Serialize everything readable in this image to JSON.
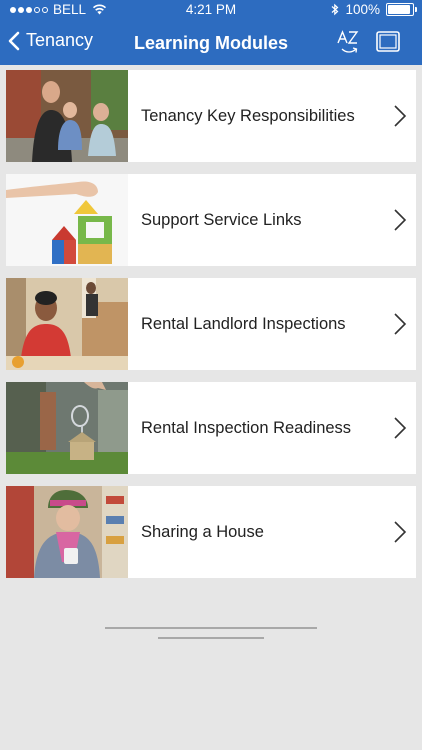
{
  "status_bar": {
    "carrier": "BELL",
    "time": "4:21 PM",
    "battery": "100%",
    "battery_level": 1.0
  },
  "nav": {
    "back_label": "Tenancy",
    "title": "Learning Modules",
    "sort_icon": "az-sort-icon",
    "view_icon": "tablet-view-icon"
  },
  "modules": [
    {
      "label": "Tenancy Key Responsibilities",
      "thumb": "family-photo"
    },
    {
      "label": "Support Service Links",
      "thumb": "toy-blocks-photo"
    },
    {
      "label": "Rental Landlord Inspections",
      "thumb": "man-in-kitchen-photo"
    },
    {
      "label": "Rental Inspection Readiness",
      "thumb": "house-keyring-photo"
    },
    {
      "label": "Sharing a House",
      "thumb": "woman-with-mug-photo"
    }
  ],
  "colors": {
    "header": "#2d6cc0",
    "background": "#e6e6e6"
  }
}
